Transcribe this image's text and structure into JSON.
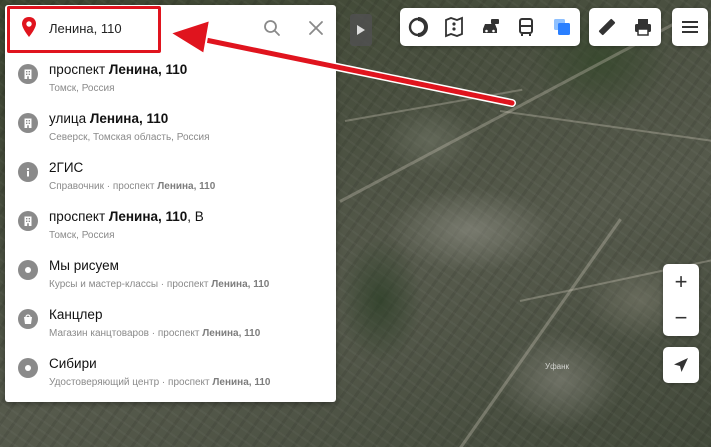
{
  "search": {
    "value": "Ленина, 110",
    "placeholder": ""
  },
  "results": [
    {
      "icon": "building-icon",
      "title_pre": "проспект ",
      "title_bold": "Ленина, 110",
      "title_post": "",
      "sub_pre": "Томск, Россия",
      "sub_bold": ""
    },
    {
      "icon": "building-icon",
      "title_pre": "улица ",
      "title_bold": "Ленина, 110",
      "title_post": "",
      "sub_pre": "Северск, Томская область, Россия",
      "sub_bold": ""
    },
    {
      "icon": "info-icon",
      "title_pre": "2ГИС",
      "title_bold": "",
      "title_post": "",
      "sub_pre": "Справочник · проспект ",
      "sub_bold": "Ленина, 110"
    },
    {
      "icon": "building-icon",
      "title_pre": "проспект ",
      "title_bold": "Ленина, 110",
      "title_post": ", В",
      "sub_pre": "Томск, Россия",
      "sub_bold": ""
    },
    {
      "icon": "dot-icon",
      "title_pre": "Мы рисуем",
      "title_bold": "",
      "title_post": "",
      "sub_pre": "Курсы и мастер-классы · проспект ",
      "sub_bold": "Ленина, 110"
    },
    {
      "icon": "shop-icon",
      "title_pre": "Канцлер",
      "title_bold": "",
      "title_post": "",
      "sub_pre": "Магазин канцтоваров · проспект ",
      "sub_bold": "Ленина, 110"
    },
    {
      "icon": "dot-icon",
      "title_pre": "Сибири",
      "title_bold": "",
      "title_post": "",
      "sub_pre": "Удостоверяющий центр · проспект ",
      "sub_bold": "Ленина, 110"
    }
  ],
  "zoom": {
    "in_label": "+",
    "out_label": "−"
  },
  "map": {
    "label": "Уфанк"
  },
  "colors": {
    "highlight": "#e0141e",
    "pin": "#e0141e",
    "accent_blue": "#2a7fff"
  }
}
